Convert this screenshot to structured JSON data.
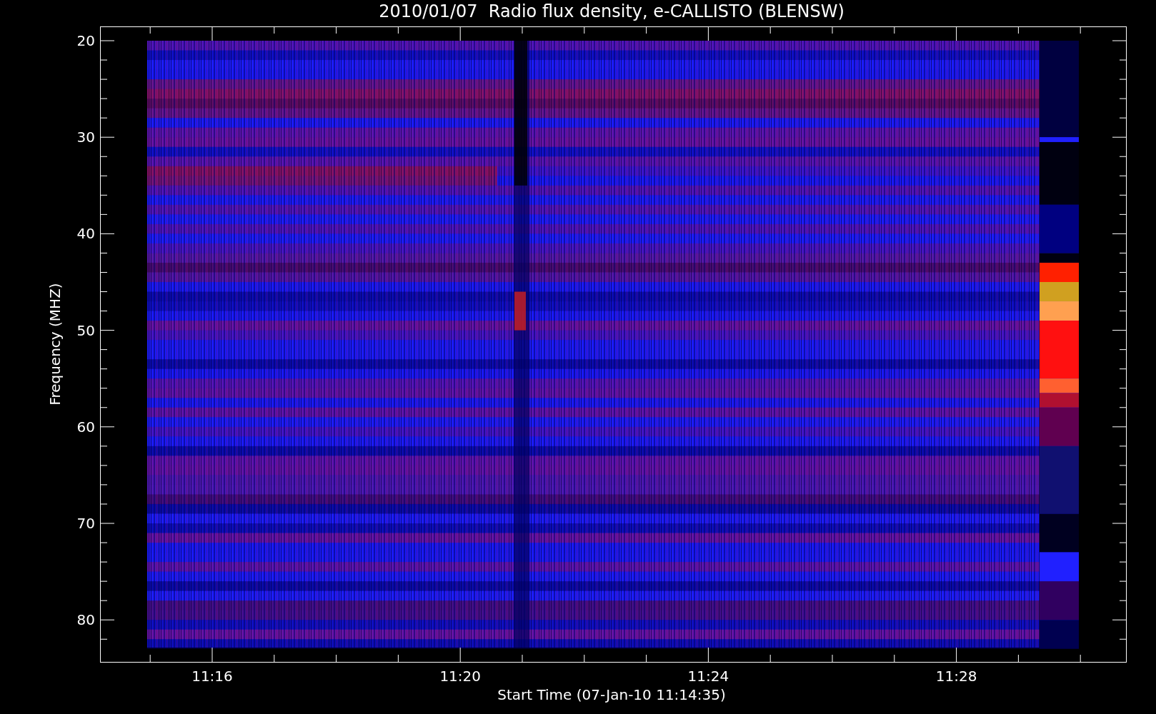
{
  "title": "2010/01/07  Radio flux density, e-CALLISTO (BLENSW)",
  "y_axis": {
    "label": "Frequency (MHZ)",
    "ticks": [
      "20",
      "30",
      "40",
      "50",
      "60",
      "70",
      "80"
    ]
  },
  "x_axis": {
    "label": "Start Time (07-Jan-10 11:14:35)",
    "ticks": [
      "11:16",
      "11:20",
      "11:24",
      "11:28"
    ]
  }
}
